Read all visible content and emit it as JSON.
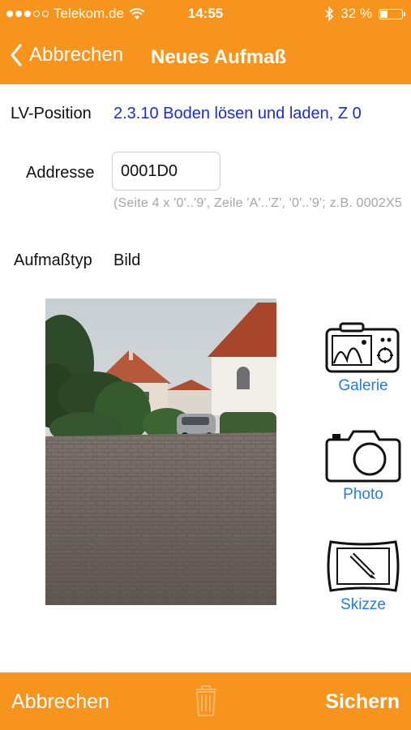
{
  "status_bar": {
    "carrier": "Telekom.de",
    "time": "14:55",
    "battery": "32 %",
    "battery_level": 0.32
  },
  "nav": {
    "back_label": "Abbrechen",
    "title": "Neues Aufmaß"
  },
  "form": {
    "lv_position_label": "LV-Position",
    "lv_position_value": "2.3.10 Boden lösen und laden, Z 0",
    "address_label": "Addresse",
    "address_value": "0001D0",
    "address_hint": "(Seite 4 x '0'..'9', Zeile 'A'..'Z', '0'..'9'; z.B. 0002X5",
    "type_label": "Aufmaßtyp",
    "type_value": "Bild"
  },
  "side_buttons": {
    "gallery": "Galerie",
    "photo": "Photo",
    "sketch": "Skizze"
  },
  "bottom_bar": {
    "cancel": "Abbrechen",
    "save": "Sichern"
  },
  "colors": {
    "accent": "#f7941d",
    "link_blue": "#1b2bd8",
    "button_blue": "#1f7fe0"
  }
}
